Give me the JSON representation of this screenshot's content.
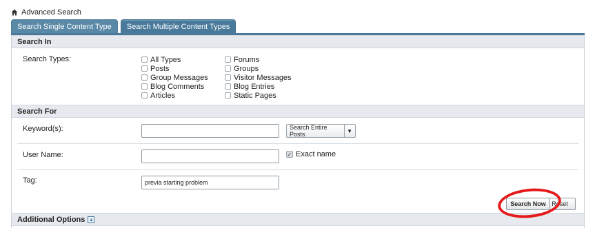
{
  "breadcrumb": {
    "label": "Advanced Search"
  },
  "tabs": [
    {
      "label": "Search Single Content Type"
    },
    {
      "label": "Search Multiple Content Types"
    }
  ],
  "search_in": {
    "heading": "Search In",
    "label": "Search Types:",
    "types_col1": [
      "All Types",
      "Posts",
      "Group Messages",
      "Blog Comments",
      "Articles"
    ],
    "types_col2": [
      "Forums",
      "Groups",
      "Visitor Messages",
      "Blog Entries",
      "Static Pages"
    ]
  },
  "search_for": {
    "heading": "Search For",
    "keywords_label": "Keyword(s):",
    "keywords_value": "",
    "scope_select": "Search Entire Posts",
    "username_label": "User Name:",
    "username_value": "",
    "exact_name_label": "Exact name",
    "tag_label": "Tag:",
    "tag_value": "previa starting problem"
  },
  "actions": {
    "search_now": "Search Now",
    "reset": "Reset"
  },
  "additional": {
    "heading": "Additional Options"
  },
  "colors": {
    "tab": "#4a7a9b",
    "highlight": "#e51b1b"
  }
}
